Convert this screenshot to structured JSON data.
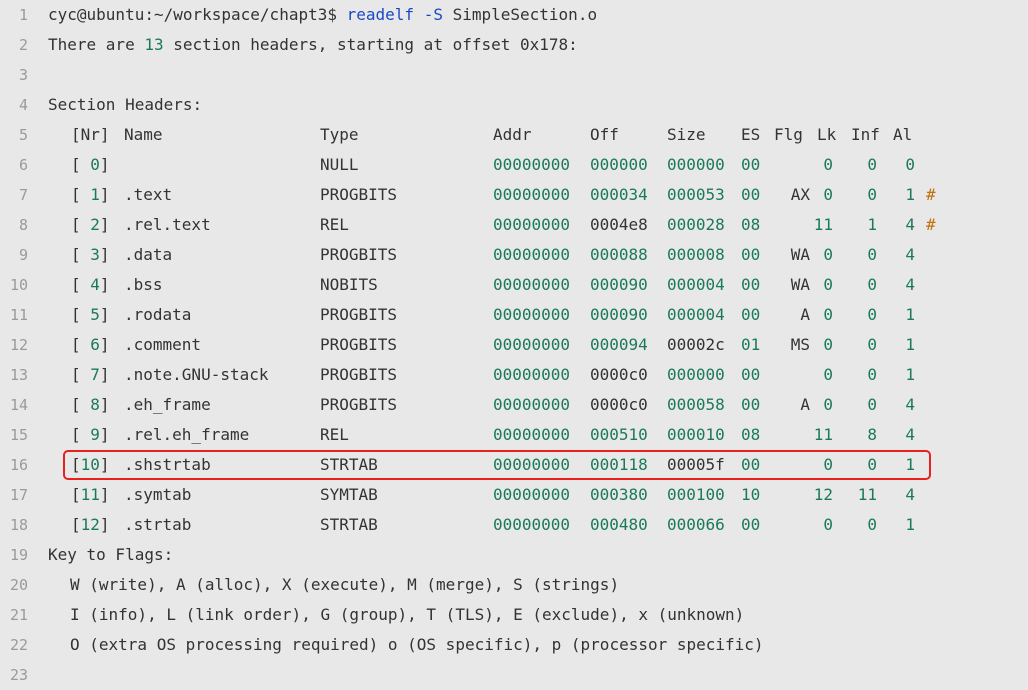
{
  "prompt": {
    "user_host_path": "cyc@ubuntu:~/workspace/chapt3$ ",
    "command": "readelf -S",
    "argument": " SimpleSection.o"
  },
  "summary": {
    "prefix": "There are ",
    "count": "13",
    "suffix": " section headers, starting at offset 0x178:"
  },
  "section_headers_title": "Section Headers:",
  "columns": {
    "nr": "[Nr]",
    "name": "Name",
    "type": "Type",
    "addr": "Addr",
    "off": "Off",
    "size": "Size",
    "es": "ES",
    "flg": "Flg",
    "lk": "Lk",
    "inf": "Inf",
    "al": "Al"
  },
  "rows": [
    {
      "nr": "[ 0]",
      "name": "",
      "type": "NULL",
      "addr": "00000000",
      "off": "000000",
      "size": "000000",
      "es": "00",
      "flg": "",
      "lk": "0",
      "inf": "0",
      "al": "0",
      "mark": ""
    },
    {
      "nr": "[ 1]",
      "name": ".text",
      "type": "PROGBITS",
      "addr": "00000000",
      "off": "000034",
      "size": "000053",
      "es": "00",
      "flg": "AX",
      "lk": "0",
      "inf": "0",
      "al": "1",
      "mark": "#"
    },
    {
      "nr": "[ 2]",
      "name": ".rel.text",
      "type": "REL",
      "addr": "00000000",
      "off": "0004e8",
      "size": "000028",
      "es": "08",
      "flg": "",
      "lk": "11",
      "inf": "1",
      "al": "4",
      "mark": "#"
    },
    {
      "nr": "[ 3]",
      "name": ".data",
      "type": "PROGBITS",
      "addr": "00000000",
      "off": "000088",
      "size": "000008",
      "es": "00",
      "flg": "WA",
      "lk": "0",
      "inf": "0",
      "al": "4",
      "mark": ""
    },
    {
      "nr": "[ 4]",
      "name": ".bss",
      "type": "NOBITS",
      "addr": "00000000",
      "off": "000090",
      "size": "000004",
      "es": "00",
      "flg": "WA",
      "lk": "0",
      "inf": "0",
      "al": "4",
      "mark": ""
    },
    {
      "nr": "[ 5]",
      "name": ".rodata",
      "type": "PROGBITS",
      "addr": "00000000",
      "off": "000090",
      "size": "000004",
      "es": "00",
      "flg": "A",
      "lk": "0",
      "inf": "0",
      "al": "1",
      "mark": ""
    },
    {
      "nr": "[ 6]",
      "name": ".comment",
      "type": "PROGBITS",
      "addr": "00000000",
      "off": "000094",
      "size": "00002c",
      "es": "01",
      "flg": "MS",
      "lk": "0",
      "inf": "0",
      "al": "1",
      "mark": ""
    },
    {
      "nr": "[ 7]",
      "name": ".note.GNU-stack",
      "type": "PROGBITS",
      "addr": "00000000",
      "off": "0000c0",
      "size": "000000",
      "es": "00",
      "flg": "",
      "lk": "0",
      "inf": "0",
      "al": "1",
      "mark": ""
    },
    {
      "nr": "[ 8]",
      "name": ".eh_frame",
      "type": "PROGBITS",
      "addr": "00000000",
      "off": "0000c0",
      "size": "000058",
      "es": "00",
      "flg": "A",
      "lk": "0",
      "inf": "0",
      "al": "4",
      "mark": ""
    },
    {
      "nr": "[ 9]",
      "name": ".rel.eh_frame",
      "type": "REL",
      "addr": "00000000",
      "off": "000510",
      "size": "000010",
      "es": "08",
      "flg": "",
      "lk": "11",
      "inf": "8",
      "al": "4",
      "mark": ""
    },
    {
      "nr": "[10]",
      "name": ".shstrtab",
      "type": "STRTAB",
      "addr": "00000000",
      "off": "000118",
      "size": "00005f",
      "es": "00",
      "flg": "",
      "lk": "0",
      "inf": "0",
      "al": "1",
      "mark": ""
    },
    {
      "nr": "[11]",
      "name": ".symtab",
      "type": "SYMTAB",
      "addr": "00000000",
      "off": "000380",
      "size": "000100",
      "es": "10",
      "flg": "",
      "lk": "12",
      "inf": "11",
      "al": "4",
      "mark": ""
    },
    {
      "nr": "[12]",
      "name": ".strtab",
      "type": "STRTAB",
      "addr": "00000000",
      "off": "000480",
      "size": "000066",
      "es": "00",
      "flg": "",
      "lk": "0",
      "inf": "0",
      "al": "1",
      "mark": ""
    }
  ],
  "flags_title": "Key to Flags:",
  "flags_lines": [
    "W (write), A (alloc), X (execute), M (merge), S (strings)",
    "I (info), L (link order), G (group), T (TLS), E (exclude), x (unknown)",
    "O (extra OS processing required) o (OS specific), p (processor specific)"
  ],
  "line_numbers": [
    "1",
    "2",
    "3",
    "4",
    "5",
    "6",
    "7",
    "8",
    "9",
    "10",
    "11",
    "12",
    "13",
    "14",
    "15",
    "16",
    "17",
    "18",
    "19",
    "20",
    "21",
    "22",
    "23"
  ],
  "colors": {
    "background": "#e8e8e8",
    "text": "#333333",
    "number": "#1a7a58",
    "comment": "#c2710c",
    "command": "#1a49c8",
    "highlight_border": "#e8201f"
  }
}
